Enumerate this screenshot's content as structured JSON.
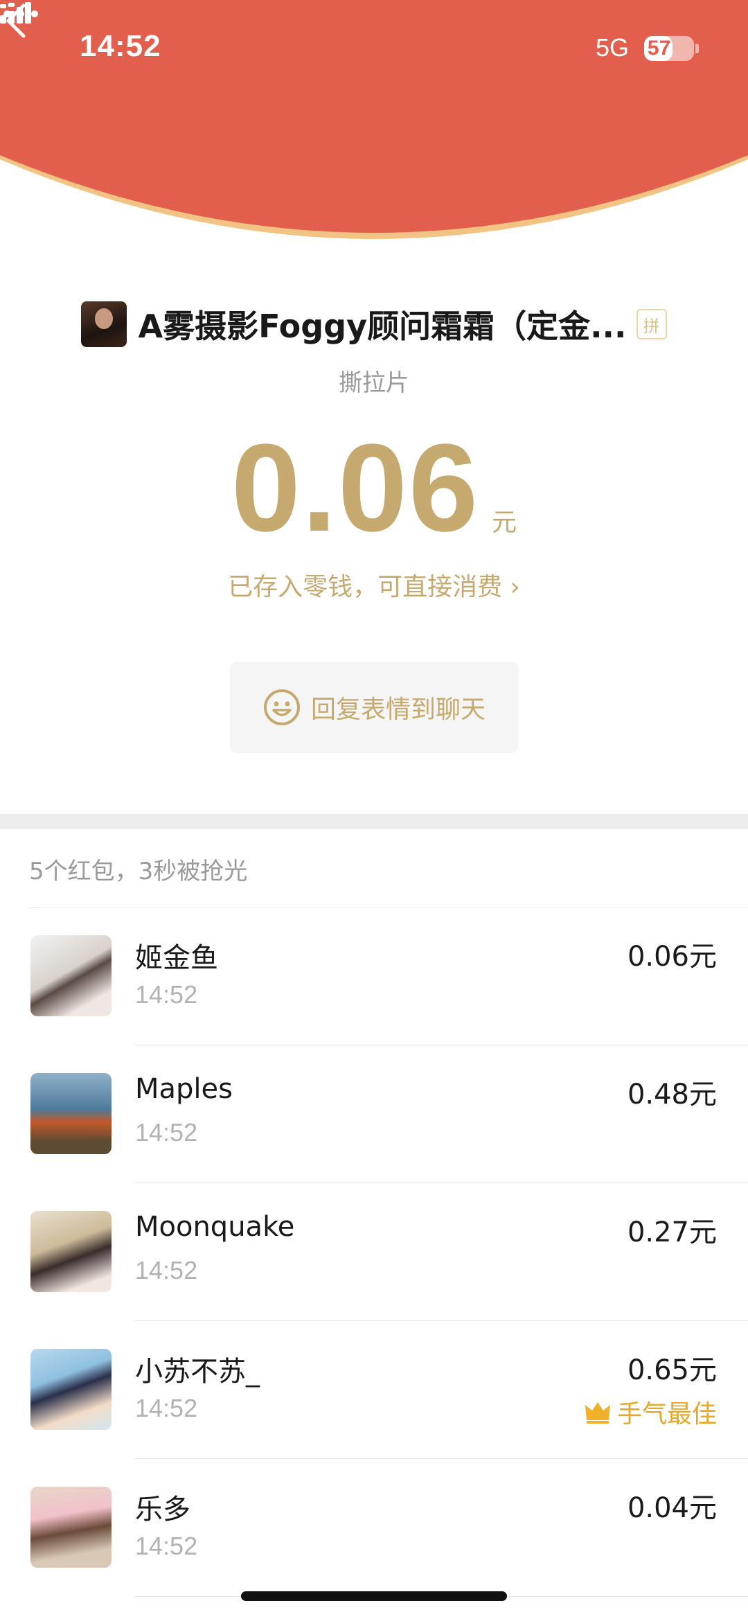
{
  "status_bar": {
    "time": "14:52",
    "network": "5G",
    "battery": "57",
    "battery_level": 0.57,
    "icons": [
      "signal-icon",
      "battery-icon"
    ]
  },
  "header": {
    "color": "#e15f4c",
    "border_color": "#f2c383",
    "back_icon": "chevron-left-icon",
    "more_icon": "more-horizontal-icon"
  },
  "sender": {
    "name": "A雾摄影Foggy顾问霜霜（定金...",
    "badge": "拼"
  },
  "packet": {
    "title": "撕拉片",
    "amount": "0.06",
    "unit": "元",
    "stored_text": "已存入零钱，可直接消费 ›",
    "reply_label": "回复表情到聊天",
    "reply_icon": "smiley-icon",
    "accent": "#c6a96e"
  },
  "summary": {
    "text": "5个红包，3秒被抢光"
  },
  "recipients": [
    {
      "name": "姬金鱼",
      "time": "14:52",
      "amount": "0.06元",
      "best": ""
    },
    {
      "name": "Maples",
      "time": "14:52",
      "amount": "0.48元",
      "best": ""
    },
    {
      "name": "Moonquake",
      "time": "14:52",
      "amount": "0.27元",
      "best": ""
    },
    {
      "name": "小苏不苏_",
      "time": "14:52",
      "amount": "0.65元",
      "best": "手气最佳"
    },
    {
      "name": "乐多",
      "time": "14:52",
      "amount": "0.04元",
      "best": ""
    }
  ]
}
